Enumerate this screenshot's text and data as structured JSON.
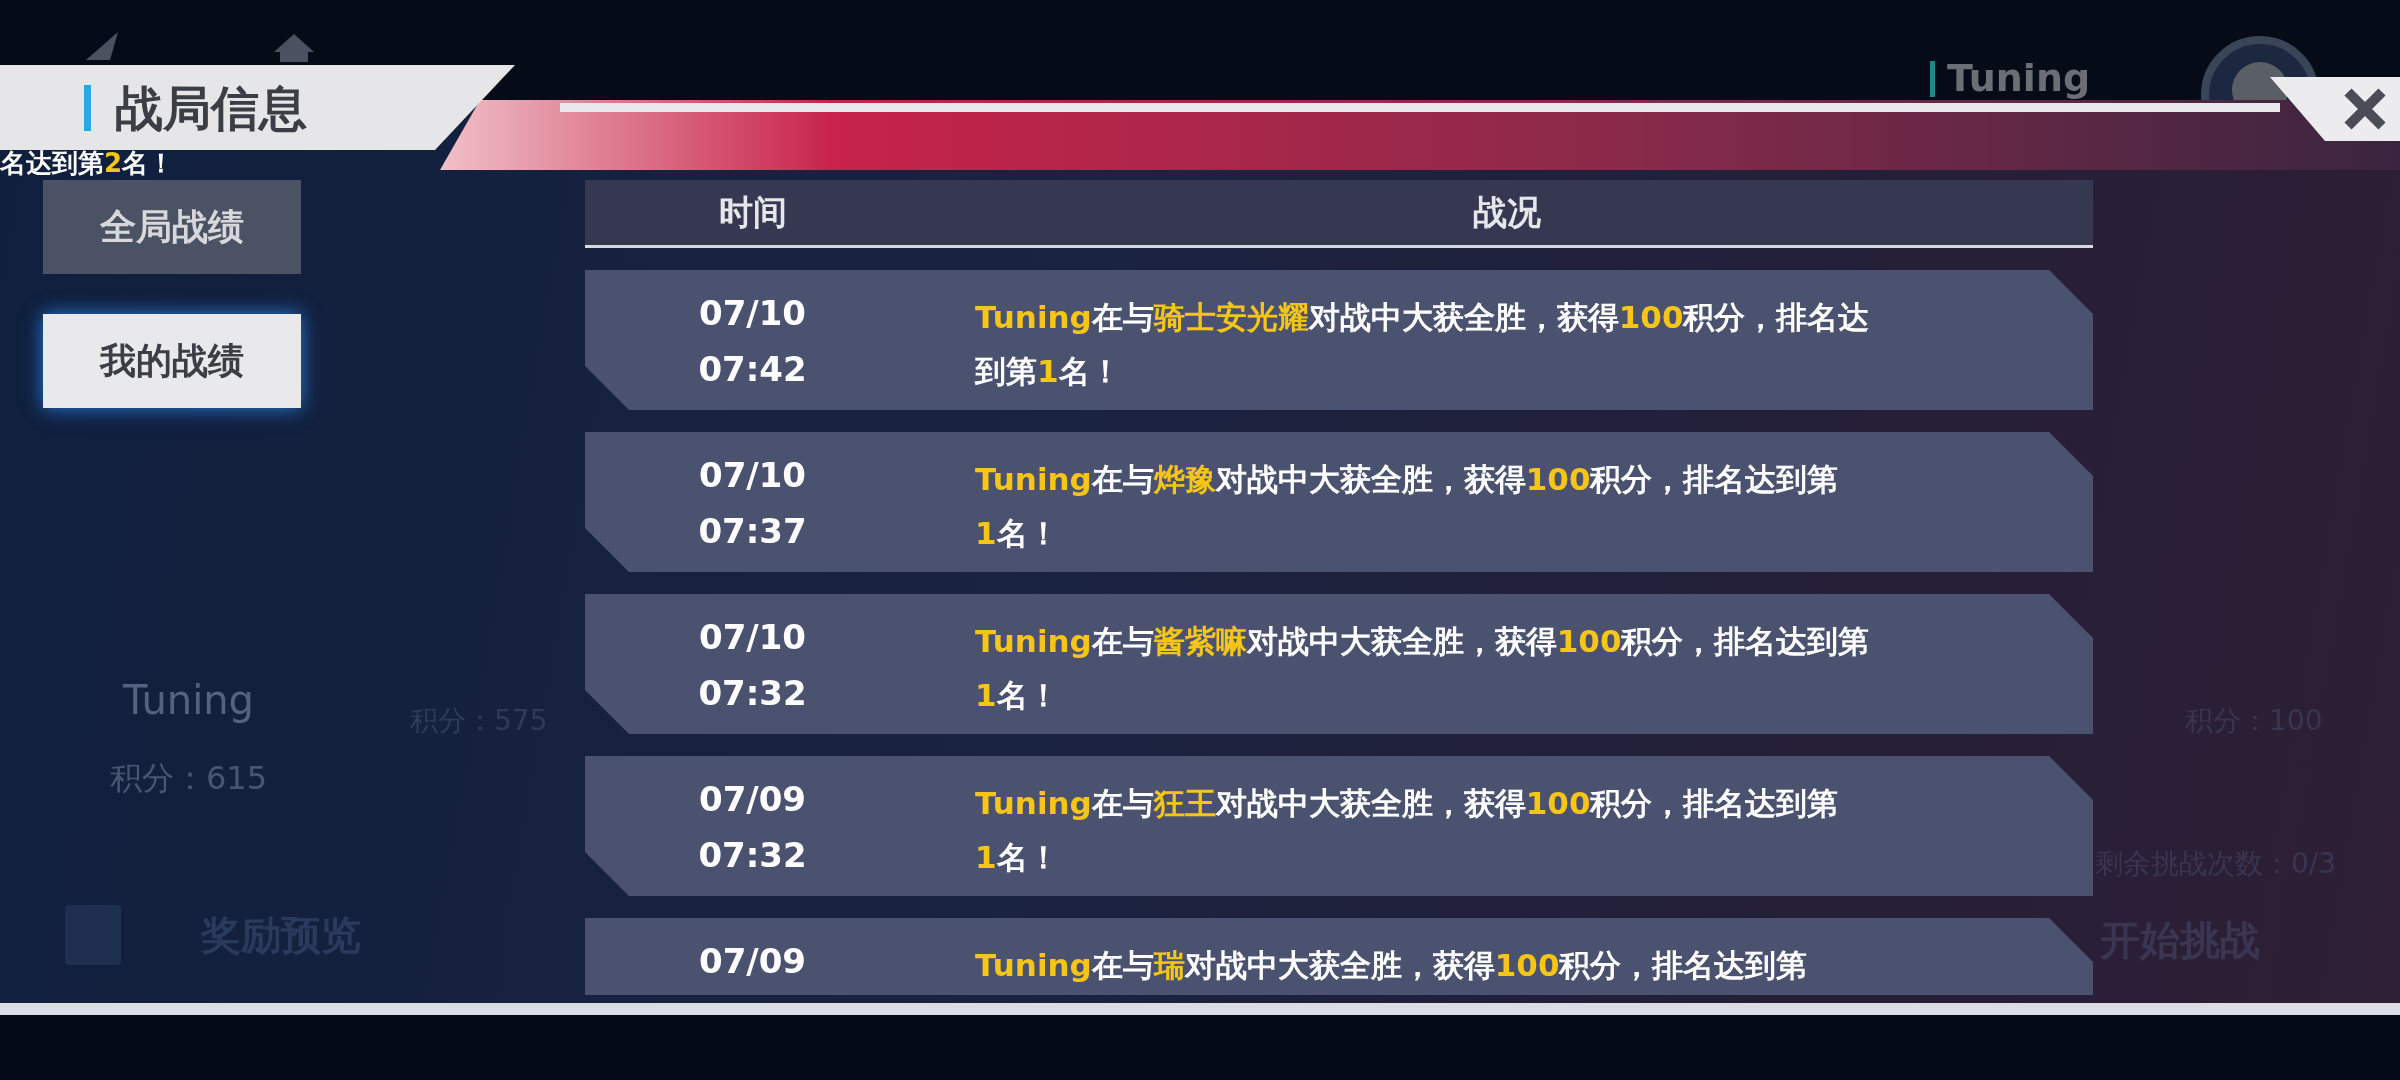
{
  "background": {
    "player_name": "Tuning",
    "notice": [
      {
        "text": "名达到第",
        "highlight": false
      },
      {
        "text": "2",
        "highlight": true
      },
      {
        "text": "名！",
        "highlight": false
      }
    ],
    "left_player": {
      "name": "Tuning",
      "score": "积分：615"
    },
    "middle_score": "积分：575",
    "right_score": "积分：100",
    "challenges_left": "剩余挑战次数：0/3",
    "reward_button": "奖励预览",
    "start_button": "开始挑战"
  },
  "dialog": {
    "title": "战局信息",
    "tabs": [
      {
        "label": "全局战绩",
        "selected": false
      },
      {
        "label": "我的战绩",
        "selected": true
      }
    ],
    "table": {
      "columns": [
        "时间",
        "战况"
      ],
      "rows": [
        {
          "date": "07/10",
          "time": "07:42",
          "lines": [
            [
              {
                "text": "Tuning",
                "highlight": true
              },
              {
                "text": "在与",
                "highlight": false
              },
              {
                "text": "骑士安光耀",
                "highlight": true
              },
              {
                "text": "对战中大获全胜，获得",
                "highlight": false
              },
              {
                "text": "100",
                "highlight": true
              },
              {
                "text": "积分，排名达",
                "highlight": false
              }
            ],
            [
              {
                "text": "到第",
                "highlight": false
              },
              {
                "text": "1",
                "highlight": true
              },
              {
                "text": "名！",
                "highlight": false
              }
            ]
          ]
        },
        {
          "date": "07/10",
          "time": "07:37",
          "lines": [
            [
              {
                "text": "Tuning",
                "highlight": true
              },
              {
                "text": "在与",
                "highlight": false
              },
              {
                "text": "烨豫",
                "highlight": true
              },
              {
                "text": "对战中大获全胜，获得",
                "highlight": false
              },
              {
                "text": "100",
                "highlight": true
              },
              {
                "text": "积分，排名达到第",
                "highlight": false
              }
            ],
            [
              {
                "text": "1",
                "highlight": true
              },
              {
                "text": "名！",
                "highlight": false
              }
            ]
          ]
        },
        {
          "date": "07/10",
          "time": "07:32",
          "lines": [
            [
              {
                "text": "Tuning",
                "highlight": true
              },
              {
                "text": "在与",
                "highlight": false
              },
              {
                "text": "酱紫嘛",
                "highlight": true
              },
              {
                "text": "对战中大获全胜，获得",
                "highlight": false
              },
              {
                "text": "100",
                "highlight": true
              },
              {
                "text": "积分，排名达到第",
                "highlight": false
              }
            ],
            [
              {
                "text": "1",
                "highlight": true
              },
              {
                "text": "名！",
                "highlight": false
              }
            ]
          ]
        },
        {
          "date": "07/09",
          "time": "07:32",
          "lines": [
            [
              {
                "text": "Tuning",
                "highlight": true
              },
              {
                "text": "在与",
                "highlight": false
              },
              {
                "text": "狂王",
                "highlight": true
              },
              {
                "text": "对战中大获全胜，获得",
                "highlight": false
              },
              {
                "text": "100",
                "highlight": true
              },
              {
                "text": "积分，排名达到第",
                "highlight": false
              }
            ],
            [
              {
                "text": "1",
                "highlight": true
              },
              {
                "text": "名！",
                "highlight": false
              }
            ]
          ]
        },
        {
          "date": "07/09",
          "lines": [
            [
              {
                "text": "Tuning",
                "highlight": true
              },
              {
                "text": "在与",
                "highlight": false
              },
              {
                "text": "瑞",
                "highlight": true
              },
              {
                "text": "对战中大获全胜，获得",
                "highlight": false
              },
              {
                "text": "100",
                "highlight": true
              },
              {
                "text": "积分，排名达到第",
                "highlight": false
              }
            ]
          ]
        }
      ]
    }
  }
}
